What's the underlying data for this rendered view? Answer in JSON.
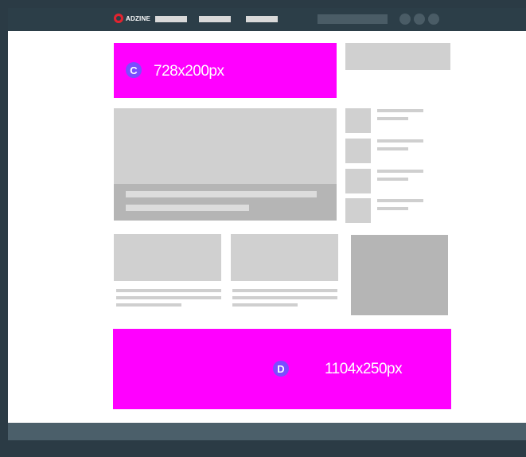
{
  "header": {
    "logo_text": "ADZINE",
    "brand_color": "#e3232f"
  },
  "ads": {
    "top": {
      "badge": "C",
      "size_label": "728x200px",
      "color": "#ff00ff"
    },
    "bottom": {
      "badge": "D",
      "size_label": "1104x250px",
      "color": "#ff00ff"
    }
  }
}
